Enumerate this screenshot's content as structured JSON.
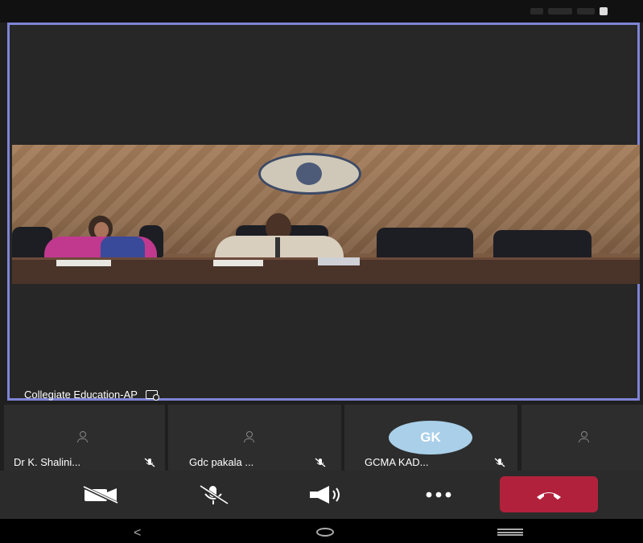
{
  "status_bar": {
    "time": "",
    "icons": [
      "signal-icon",
      "wifi-icon",
      "battery-icon"
    ]
  },
  "main_video": {
    "label": "Collegiate Education-AP",
    "label_icon": "pinned-screen-icon",
    "border_color": "#7f84d6"
  },
  "participants": [
    {
      "name": "Dr K. Shalini...",
      "avatar": "person-icon",
      "muted": true
    },
    {
      "name": "Gdc pakala ...",
      "avatar": "person-icon",
      "muted": true
    },
    {
      "name": "GCMA KAD...",
      "avatar_initials": "GK",
      "avatar_color": "#a9cfe9",
      "muted": true
    },
    {
      "name": "",
      "avatar": "person-icon",
      "muted": false
    }
  ],
  "toolbar": {
    "buttons": [
      "camera-off-icon",
      "mic-off-icon",
      "speaker-icon",
      "more-options-icon",
      "hang-up-icon"
    ],
    "hangup_color": "#b2213b"
  },
  "nav_bar": {
    "buttons": [
      "back-icon",
      "home-icon",
      "recent-apps-icon"
    ]
  }
}
